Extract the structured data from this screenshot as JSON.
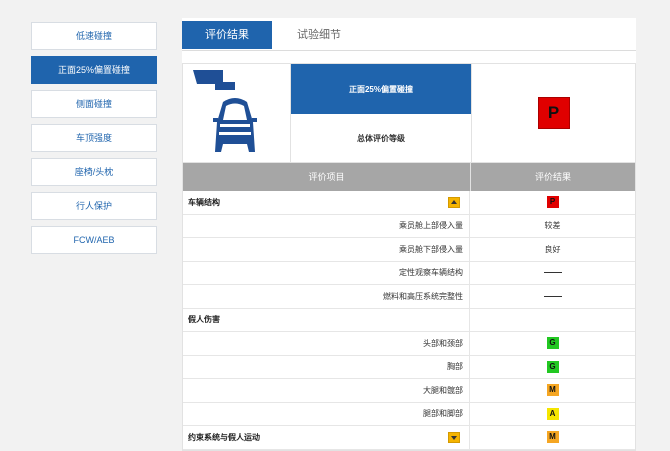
{
  "sidebar": {
    "items": [
      {
        "label": "低速碰撞",
        "active": false
      },
      {
        "label": "正面25%偏置碰撞",
        "active": true
      },
      {
        "label": "侧面碰撞",
        "active": false
      },
      {
        "label": "车顶强度",
        "active": false
      },
      {
        "label": "座椅/头枕",
        "active": false
      },
      {
        "label": "行人保护",
        "active": false
      },
      {
        "label": "FCW/AEB",
        "active": false
      }
    ]
  },
  "tabs": [
    {
      "label": "评价结果",
      "active": true
    },
    {
      "label": "试验细节",
      "active": false
    }
  ],
  "summary": {
    "test_name": "正面25%偏置碰撞",
    "overall_label": "总体评价等级",
    "overall_rating": "P",
    "overall_color": "#e00000"
  },
  "table": {
    "col_item": "评价项目",
    "col_result": "评价结果",
    "rows": [
      {
        "type": "cat",
        "label": "车辆结构",
        "arrow": "up",
        "badge": "P",
        "badge_color": "#e00000"
      },
      {
        "type": "sub",
        "label": "乘员舱上部侵入量",
        "text": "较差"
      },
      {
        "type": "sub",
        "label": "乘员舱下部侵入量",
        "text": "良好"
      },
      {
        "type": "sub",
        "label": "定性观察车辆结构",
        "dash": true
      },
      {
        "type": "sub",
        "label": "燃料和高压系统完整性",
        "dash": true
      },
      {
        "type": "cat",
        "label": "假人伤害"
      },
      {
        "type": "sub",
        "label": "头部和颈部",
        "badge": "G",
        "badge_color": "#22c822"
      },
      {
        "type": "sub",
        "label": "胸部",
        "badge": "G",
        "badge_color": "#22c822"
      },
      {
        "type": "sub",
        "label": "大腿和髋部",
        "badge": "M",
        "badge_color": "#f5a623"
      },
      {
        "type": "sub",
        "label": "腿部和脚部",
        "badge": "A",
        "badge_color": "#f5e600"
      },
      {
        "type": "cat",
        "label": "约束系统与假人运动",
        "arrow": "down",
        "badge": "M",
        "badge_color": "#f5a623"
      }
    ]
  },
  "icons": {
    "test_icon": "offset-crash-car-icon"
  },
  "colors": {
    "accent": "#1f64ad",
    "header_gray": "#a6a6a6"
  }
}
